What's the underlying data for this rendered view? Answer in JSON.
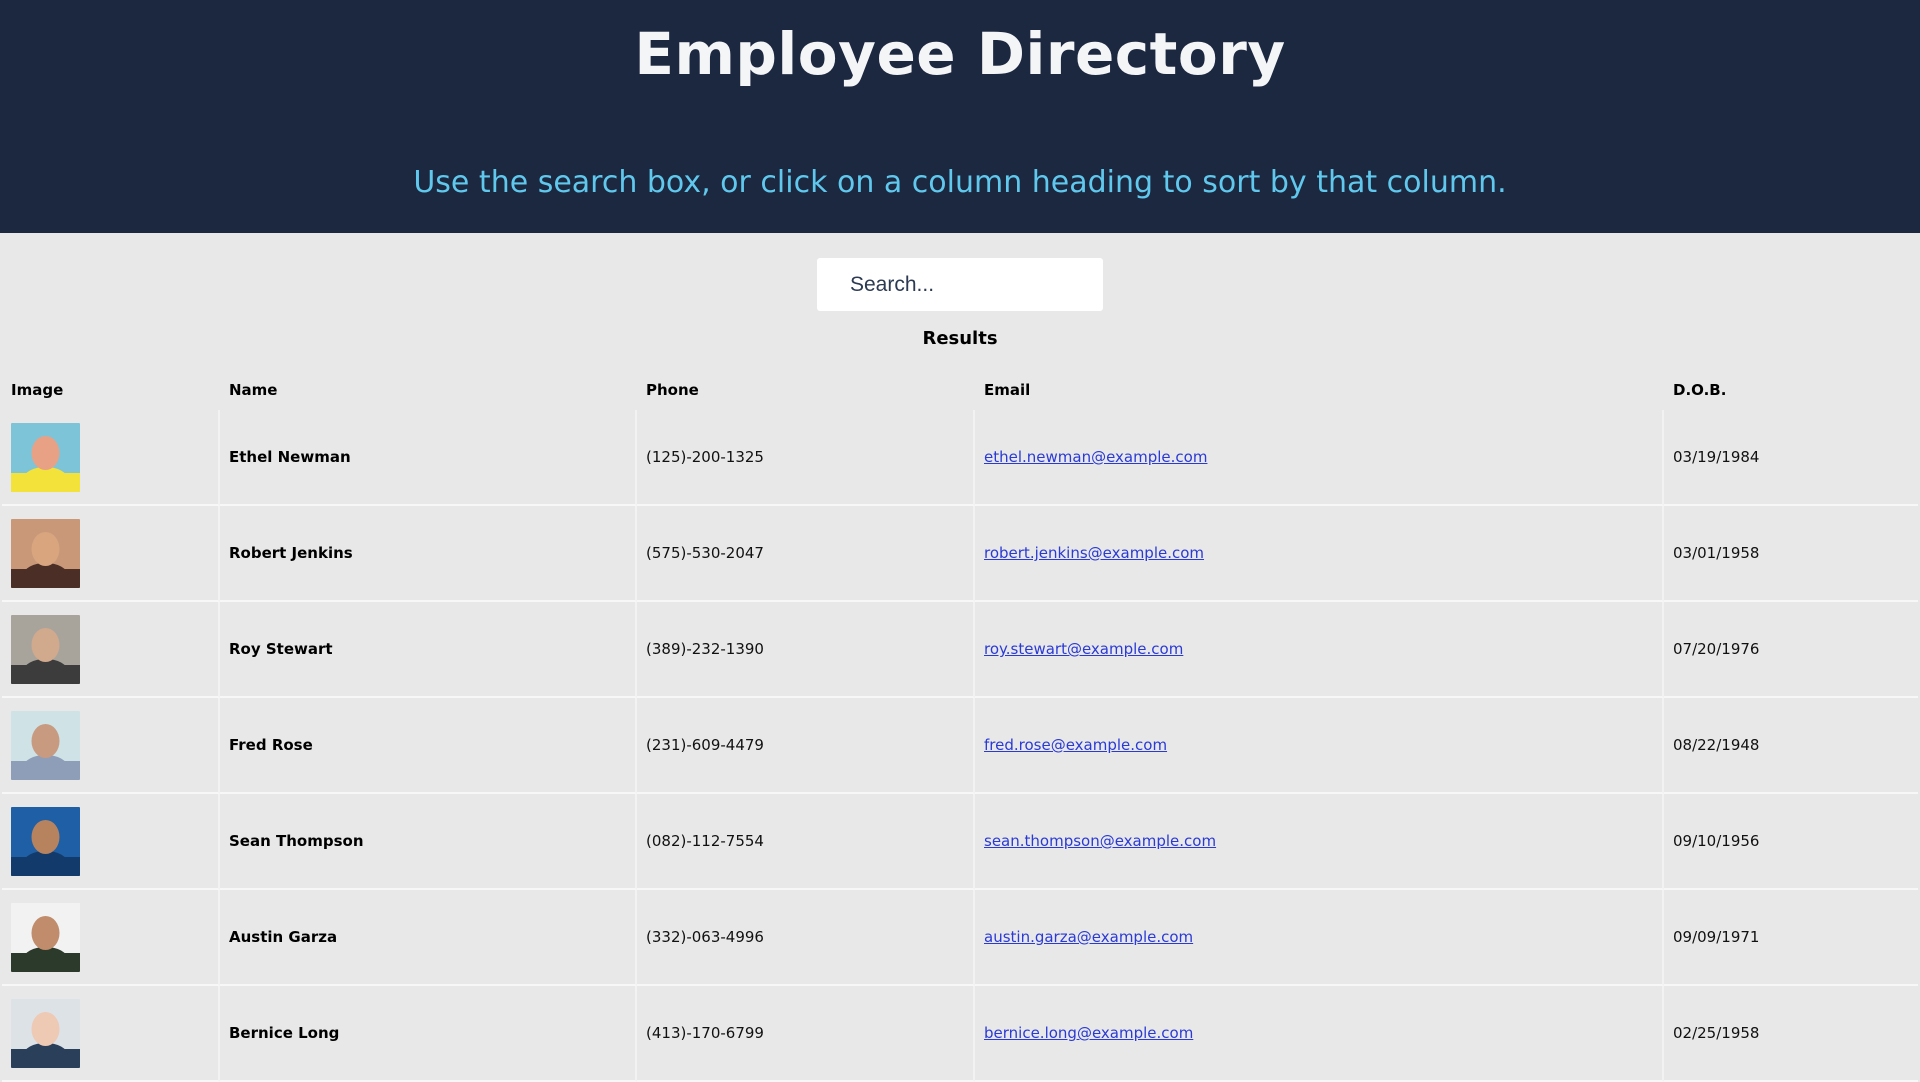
{
  "header": {
    "title": "Employee Directory",
    "subtitle": "Use the search box, or click on a column heading to sort by that column."
  },
  "search": {
    "placeholder": "Search...",
    "value": ""
  },
  "results_label": "Results",
  "columns": [
    "Image",
    "Name",
    "Phone",
    "Email",
    "D.O.B."
  ],
  "employees": [
    {
      "name": "Ethel Newman",
      "phone": "(125)-200-1325",
      "email": "ethel.newman@example.com",
      "dob": "03/19/1984",
      "avatar_colors": [
        "#7ec4d8",
        "#e8a184",
        "#f2e23a"
      ]
    },
    {
      "name": "Robert Jenkins",
      "phone": "(575)-530-2047",
      "email": "robert.jenkins@example.com",
      "dob": "03/01/1958",
      "avatar_colors": [
        "#c89878",
        "#d8a57f",
        "#4b2e26"
      ]
    },
    {
      "name": "Roy Stewart",
      "phone": "(389)-232-1390",
      "email": "roy.stewart@example.com",
      "dob": "07/20/1976",
      "avatar_colors": [
        "#a8a49c",
        "#d1a98d",
        "#3c3c3c"
      ]
    },
    {
      "name": "Fred Rose",
      "phone": "(231)-609-4479",
      "email": "fred.rose@example.com",
      "dob": "08/22/1948",
      "avatar_colors": [
        "#cfe2e6",
        "#c89a80",
        "#8e9eb8"
      ]
    },
    {
      "name": "Sean Thompson",
      "phone": "(082)-112-7554",
      "email": "sean.thompson@example.com",
      "dob": "09/10/1956",
      "avatar_colors": [
        "#1e5fa5",
        "#b7835f",
        "#123a6a"
      ]
    },
    {
      "name": "Austin Garza",
      "phone": "(332)-063-4996",
      "email": "austin.garza@example.com",
      "dob": "09/09/1971",
      "avatar_colors": [
        "#f2f2f2",
        "#c08c6c",
        "#2c3a2c"
      ]
    },
    {
      "name": "Bernice Long",
      "phone": "(413)-170-6799",
      "email": "bernice.long@example.com",
      "dob": "02/25/1958",
      "avatar_colors": [
        "#dde2e6",
        "#eec9b4",
        "#2a3f5a"
      ]
    }
  ]
}
